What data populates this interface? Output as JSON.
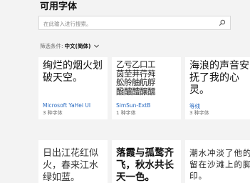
{
  "page": {
    "title": "可用字体"
  },
  "search": {
    "placeholder": "在此输入进行搜索。"
  },
  "filter": {
    "label": "筛选条件:",
    "value": "中文(简体)"
  },
  "fonts": [
    {
      "preview": "绚烂的烟火划破天空。",
      "name": "Microsoft YaHei UI",
      "count": "3 种字体"
    },
    {
      "preview": "乙亏乙口工\n茵茔荓荇荈\n舩舲舳航艀\n醱醲醴醸醹",
      "name": "SimSun-ExtB",
      "count": "1 种字体"
    },
    {
      "preview": "海浪的声音安抚了我的心灵。",
      "name": "等线",
      "count": "3 种字体"
    },
    {
      "preview": "日出江花红似火，春来江水绿如蓝。",
      "name": "",
      "count": ""
    },
    {
      "preview": "落霞与孤鹜齐飞，秋水共长天一色。",
      "name": "",
      "count": ""
    },
    {
      "preview": "潮水冲淡了他的留在沙滩上的脚印。",
      "name": "",
      "count": ""
    }
  ],
  "colors": {
    "link": "#2a6bc1",
    "background": "#f3f3f3",
    "card": "#ffffff"
  }
}
